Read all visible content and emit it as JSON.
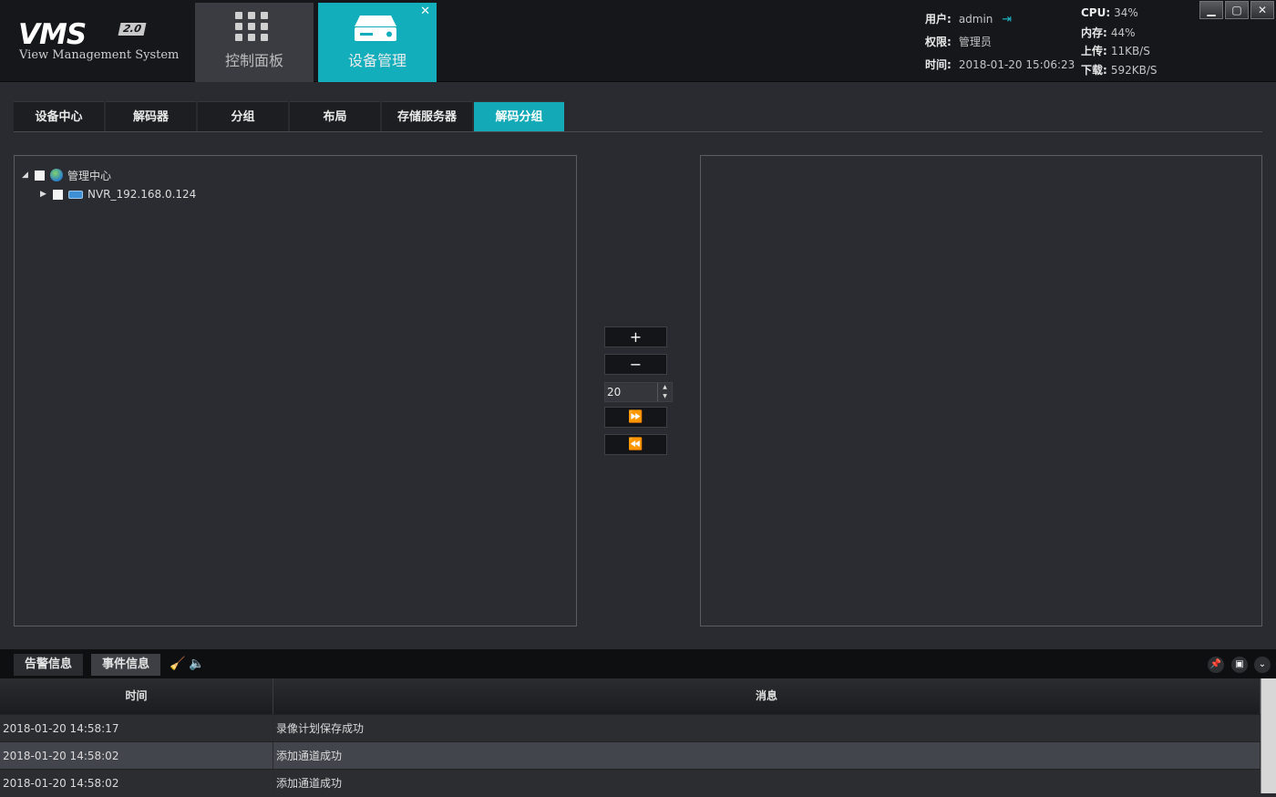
{
  "app": {
    "logo": "VMS",
    "version": "2.0",
    "subtitle": "View Management System"
  },
  "top_tabs": [
    {
      "label": "控制面板",
      "icon": "grid-icon",
      "active": false
    },
    {
      "label": "设备管理",
      "icon": "drive-icon",
      "active": true
    }
  ],
  "header_info": {
    "user_label": "用户:",
    "user_value": "admin",
    "perm_label": "权限:",
    "perm_value": "管理员",
    "time_label": "时间:",
    "time_value": "2018-01-20 15:06:23",
    "cpu_label": "CPU:",
    "cpu_value": "34%",
    "mem_label": "内存:",
    "mem_value": "44%",
    "up_label": "上传:",
    "up_value": "11KB/S",
    "down_label": "下载:",
    "down_value": "592KB/S"
  },
  "sub_tabs": [
    {
      "label": "设备中心",
      "active": false
    },
    {
      "label": "解码器",
      "active": false
    },
    {
      "label": "分组",
      "active": false
    },
    {
      "label": "布局",
      "active": false
    },
    {
      "label": "存储服务器",
      "active": false
    },
    {
      "label": "解码分组",
      "active": true
    }
  ],
  "tree": {
    "root": "管理中心",
    "child": "NVR_192.168.0.124"
  },
  "controls": {
    "add": "+",
    "remove": "−",
    "count": "20",
    "forward": "⏩",
    "back": "⏪"
  },
  "bottom": {
    "tab_alarm": "告警信息",
    "tab_event": "事件信息",
    "col_time": "时间",
    "col_msg": "消息",
    "rows": [
      {
        "time": "2018-01-20 14:58:17",
        "msg": "录像计划保存成功"
      },
      {
        "time": "2018-01-20 14:58:02",
        "msg": "添加通道成功"
      },
      {
        "time": "2018-01-20 14:58:02",
        "msg": "添加通道成功"
      }
    ]
  },
  "colors": {
    "accent": "#12aebc",
    "bg": "#2a2b30",
    "header": "#16171b"
  }
}
